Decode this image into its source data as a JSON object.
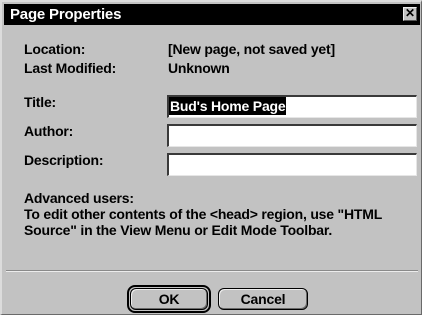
{
  "window": {
    "title": "Page Properties",
    "close_glyph": "✕"
  },
  "info": {
    "location_label": "Location:",
    "location_value": "[New page, not saved yet]",
    "modified_label": "Last Modified:",
    "modified_value": "Unknown"
  },
  "fields": {
    "title_label": "Title:",
    "title_value": "Bud's Home Page",
    "author_label": "Author:",
    "author_value": "",
    "description_label": "Description:",
    "description_value": ""
  },
  "note": {
    "heading": "Advanced users:",
    "body": "To edit other contents of the <head> region, use \"HTML Source\" in the View Menu or Edit Mode Toolbar."
  },
  "buttons": {
    "ok_label": "OK",
    "cancel_label": "Cancel"
  }
}
